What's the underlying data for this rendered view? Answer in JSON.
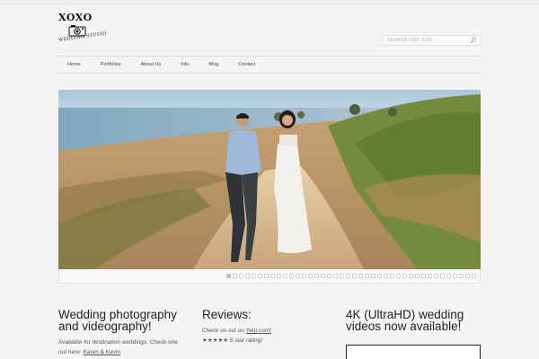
{
  "logo": {
    "title": "XOXO",
    "subtitle": "WEDDING STUDIO",
    "icon": "camera-icon"
  },
  "search": {
    "placeholder": "SEARCH OUR SITE",
    "icon": "search-icon"
  },
  "nav": {
    "items": [
      {
        "label": "Home"
      },
      {
        "label": "Portfolios"
      },
      {
        "label": "About Us"
      },
      {
        "label": "Info"
      },
      {
        "label": "Blog"
      },
      {
        "label": "Contact"
      }
    ]
  },
  "slider": {
    "slide_count": 40,
    "active_index": 0
  },
  "columns": {
    "col1": {
      "heading_line1": "Wedding photography",
      "heading_line2": "and videography!",
      "text_line1": "Available for destination weddings. Check one",
      "text_line2_prefix": "out here: ",
      "link": "Karen & Kevin"
    },
    "col2": {
      "heading": "Reviews:",
      "text_prefix": "Check us out on ",
      "link": "Yelp.com!",
      "rating": "★★★★★ 5 star rating!"
    },
    "col3": {
      "heading_line1": "4K (UltraHD) wedding",
      "heading_line2": "videos now available!"
    }
  }
}
